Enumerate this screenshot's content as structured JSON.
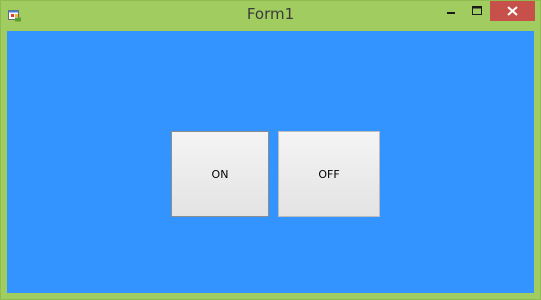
{
  "window": {
    "title": "Form1",
    "app_icon": "windows-form-icon",
    "controls": {
      "minimize_icon": "minimize-icon",
      "maximize_icon": "maximize-icon",
      "close_icon": "close-icon"
    }
  },
  "colors": {
    "frame": "#a1cd60",
    "client_background": "#3393ff",
    "close_button": "#c7504b"
  },
  "buttons": {
    "on_label": "ON",
    "off_label": "OFF"
  }
}
